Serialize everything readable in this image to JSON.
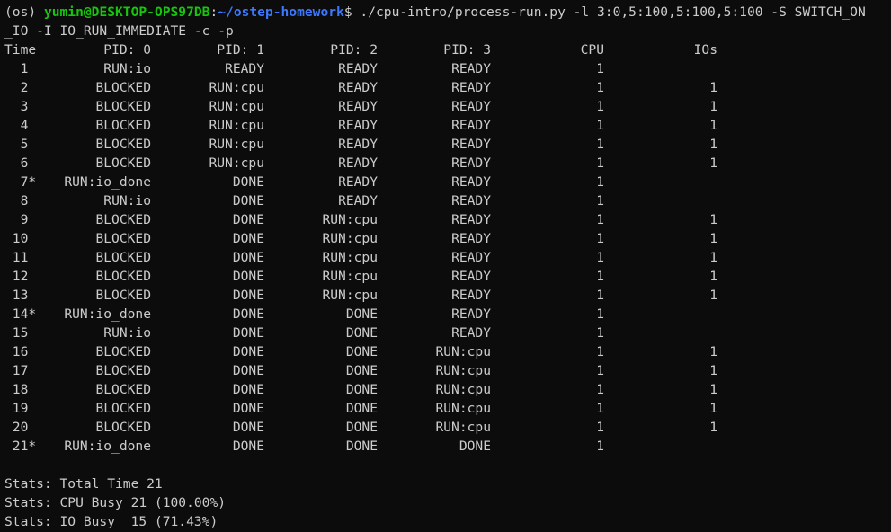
{
  "prompt": {
    "env": "(os) ",
    "user_host": "yumin@DESKTOP-OPS97DB",
    "sep": ":",
    "path": "~/ostep-homework",
    "dollar": "$ ",
    "command_part1": "./cpu-intro/process-run.py -l 3:0,5:100,5:100,5:100 -S SWITCH_ON",
    "command_part2": "_IO -I IO_RUN_IMMEDIATE -c -p"
  },
  "table": {
    "headers": [
      "Time",
      "PID: 0",
      "PID: 1",
      "PID: 2",
      "PID: 3",
      "CPU",
      "IOs"
    ],
    "rows": [
      [
        "1",
        "RUN:io",
        "READY",
        "READY",
        "READY",
        "1",
        ""
      ],
      [
        "2",
        "BLOCKED",
        "RUN:cpu",
        "READY",
        "READY",
        "1",
        "1"
      ],
      [
        "3",
        "BLOCKED",
        "RUN:cpu",
        "READY",
        "READY",
        "1",
        "1"
      ],
      [
        "4",
        "BLOCKED",
        "RUN:cpu",
        "READY",
        "READY",
        "1",
        "1"
      ],
      [
        "5",
        "BLOCKED",
        "RUN:cpu",
        "READY",
        "READY",
        "1",
        "1"
      ],
      [
        "6",
        "BLOCKED",
        "RUN:cpu",
        "READY",
        "READY",
        "1",
        "1"
      ],
      [
        "7*",
        "RUN:io_done",
        "DONE",
        "READY",
        "READY",
        "1",
        ""
      ],
      [
        "8",
        "RUN:io",
        "DONE",
        "READY",
        "READY",
        "1",
        ""
      ],
      [
        "9",
        "BLOCKED",
        "DONE",
        "RUN:cpu",
        "READY",
        "1",
        "1"
      ],
      [
        "10",
        "BLOCKED",
        "DONE",
        "RUN:cpu",
        "READY",
        "1",
        "1"
      ],
      [
        "11",
        "BLOCKED",
        "DONE",
        "RUN:cpu",
        "READY",
        "1",
        "1"
      ],
      [
        "12",
        "BLOCKED",
        "DONE",
        "RUN:cpu",
        "READY",
        "1",
        "1"
      ],
      [
        "13",
        "BLOCKED",
        "DONE",
        "RUN:cpu",
        "READY",
        "1",
        "1"
      ],
      [
        "14*",
        "RUN:io_done",
        "DONE",
        "DONE",
        "READY",
        "1",
        ""
      ],
      [
        "15",
        "RUN:io",
        "DONE",
        "DONE",
        "READY",
        "1",
        ""
      ],
      [
        "16",
        "BLOCKED",
        "DONE",
        "DONE",
        "RUN:cpu",
        "1",
        "1"
      ],
      [
        "17",
        "BLOCKED",
        "DONE",
        "DONE",
        "RUN:cpu",
        "1",
        "1"
      ],
      [
        "18",
        "BLOCKED",
        "DONE",
        "DONE",
        "RUN:cpu",
        "1",
        "1"
      ],
      [
        "19",
        "BLOCKED",
        "DONE",
        "DONE",
        "RUN:cpu",
        "1",
        "1"
      ],
      [
        "20",
        "BLOCKED",
        "DONE",
        "DONE",
        "RUN:cpu",
        "1",
        "1"
      ],
      [
        "21*",
        "RUN:io_done",
        "DONE",
        "DONE",
        "DONE",
        "1",
        ""
      ]
    ]
  },
  "stats": [
    "Stats: Total Time 21",
    "Stats: CPU Busy 21 (100.00%)",
    "Stats: IO Busy  15 (71.43%)"
  ],
  "colors": {
    "background": "#0c0c0c",
    "text": "#cccccc",
    "user_host": "#16c60c",
    "path": "#3b78ff"
  }
}
